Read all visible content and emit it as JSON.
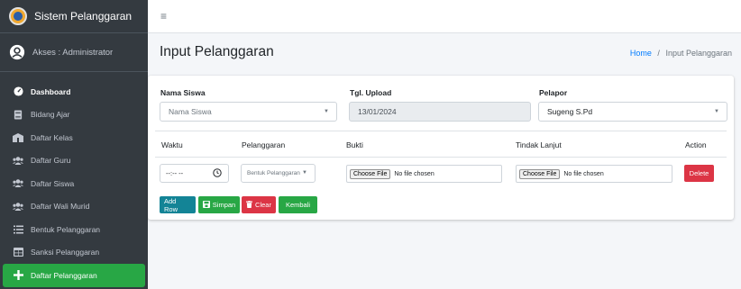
{
  "sidebar": {
    "brand": "Sistem Pelanggaran",
    "user": "Akses : Administrator",
    "items": [
      {
        "label": "Dashboard",
        "icon": "dashboard-gauge-icon"
      },
      {
        "label": "Bidang Ajar",
        "icon": "book-icon"
      },
      {
        "label": "Daftar Kelas",
        "icon": "school-icon"
      },
      {
        "label": "Daftar Guru",
        "icon": "users-icon"
      },
      {
        "label": "Daftar Siswa",
        "icon": "users-icon"
      },
      {
        "label": "Daftar Wali Murid",
        "icon": "users-icon"
      },
      {
        "label": "Bentuk Pelanggaran",
        "icon": "list-icon"
      },
      {
        "label": "Sanksi Pelanggaran",
        "icon": "table-icon"
      },
      {
        "label": "Daftar Pelanggaran",
        "icon": "plus-icon"
      }
    ],
    "active_color": "#28a745"
  },
  "header": {
    "title": "Input Pelanggaran",
    "breadcrumb": {
      "home": "Home",
      "separator": "/",
      "current": "Input Pelanggaran"
    }
  },
  "form": {
    "nama_siswa": {
      "label": "Nama Siswa",
      "placeholder": "Nama Siswa"
    },
    "tgl_upload": {
      "label": "Tgl. Upload",
      "value": "13/01/2024"
    },
    "pelapor": {
      "label": "Pelapor",
      "value": "Sugeng S.Pd"
    }
  },
  "table": {
    "headers": [
      "Waktu",
      "Pelanggaran",
      "Bukti",
      "Tindak Lanjut",
      "Action"
    ],
    "row": {
      "waktu": "--:-- --",
      "pelanggaran_placeholder": "Bentuk Pelanggaran",
      "bukti_button": "Choose File",
      "bukti_status": "No file chosen",
      "tindak_button": "Choose File",
      "tindak_status": "No file chosen",
      "delete": "Delete"
    }
  },
  "buttons": {
    "add_row": "Add Row",
    "simpan": "Simpan",
    "clear": "Clear",
    "kembali": "Kembali"
  },
  "colors": {
    "info": "#138496",
    "success": "#28a745",
    "danger": "#dc3545",
    "link": "#007bff",
    "sidebar_bg": "#343a40"
  }
}
